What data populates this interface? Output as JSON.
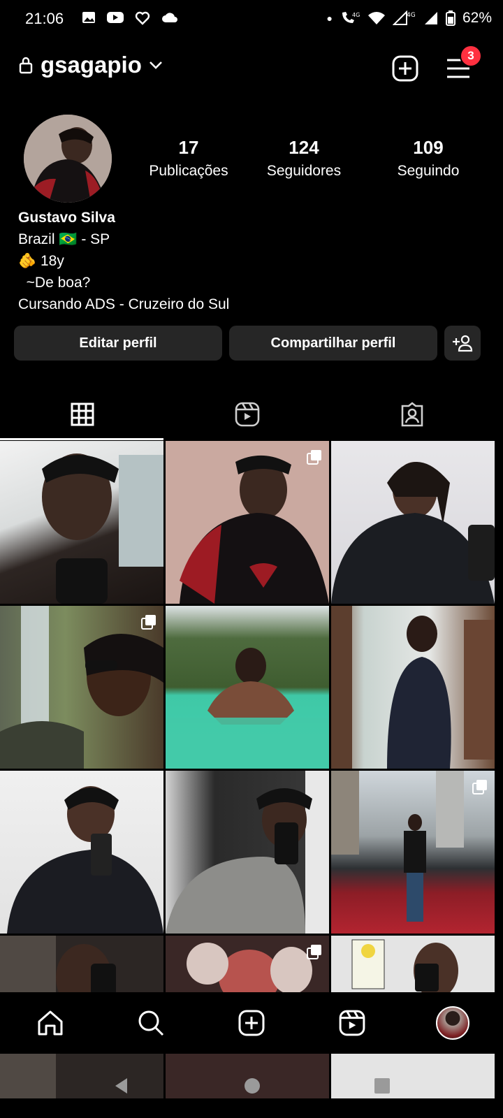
{
  "status_bar": {
    "time": "21:06",
    "battery": "62%"
  },
  "header": {
    "username": "gsagapio",
    "notification_count": "3"
  },
  "profile": {
    "stats": [
      {
        "value": "17",
        "label": "Publicações"
      },
      {
        "value": "124",
        "label": "Seguidores"
      },
      {
        "value": "109",
        "label": "Seguindo"
      }
    ],
    "name": "Gustavo Silva",
    "bio_lines": [
      "Brazil 🇧🇷 - SP",
      "🫵 18y",
      "  ~De boa?",
      "Cursando ADS - Cruzeiro do Sul"
    ]
  },
  "actions": {
    "edit_label": "Editar perfil",
    "share_label": "Compartilhar perfil"
  },
  "tabs": [
    {
      "name": "posts-grid",
      "icon": "grid-icon",
      "active": true
    },
    {
      "name": "reels",
      "icon": "reels-icon",
      "active": false
    },
    {
      "name": "tagged",
      "icon": "tagged-person-icon",
      "active": false
    }
  ],
  "posts": [
    {
      "icon": "none"
    },
    {
      "icon": "carousel-icon"
    },
    {
      "icon": "none"
    },
    {
      "icon": "carousel-icon"
    },
    {
      "icon": "none"
    },
    {
      "icon": "none"
    },
    {
      "icon": "none"
    },
    {
      "icon": "none"
    },
    {
      "icon": "carousel-icon"
    },
    {
      "icon": "none"
    },
    {
      "icon": "carousel-icon"
    },
    {
      "icon": "none"
    }
  ],
  "bottom_nav": [
    "home-icon",
    "search-icon",
    "create-icon",
    "reels-icon",
    "profile-avatar"
  ]
}
